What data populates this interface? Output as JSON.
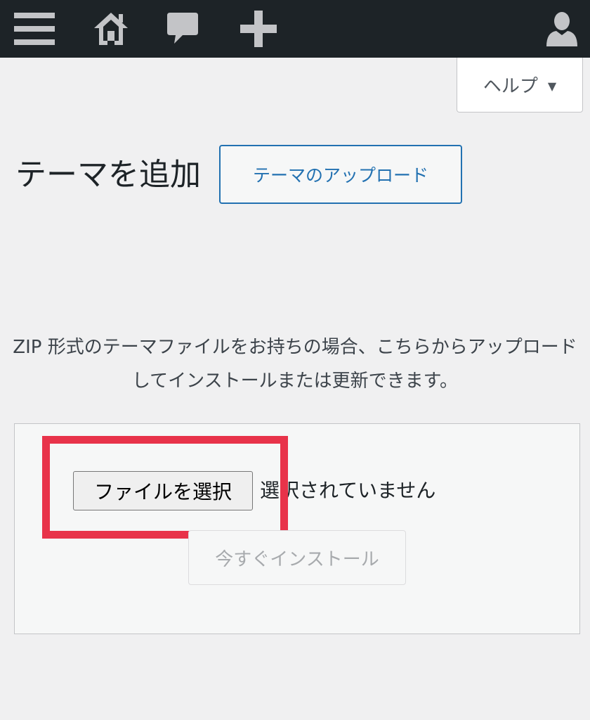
{
  "adminbar": {
    "icons": [
      "menu-icon",
      "home-icon",
      "comment-icon",
      "plus-icon",
      "user-icon"
    ],
    "background": "#1d2327",
    "icon_color": "#c3c4c7"
  },
  "help": {
    "label": "ヘルプ",
    "caret": "▼"
  },
  "page": {
    "title": "テーマを追加",
    "upload_button": "テーマのアップロード"
  },
  "upload": {
    "description": "ZIP 形式のテーマファイルをお持ちの場合、こちらからアップロードしてインストールまたは更新できます。",
    "choose_file_button": "ファイルを選択",
    "file_status": "選択されていません",
    "install_button": "今すぐインストール",
    "install_disabled": true
  },
  "colors": {
    "accent": "#2271b1",
    "highlight": "#e8334a",
    "background": "#f0f0f1"
  }
}
